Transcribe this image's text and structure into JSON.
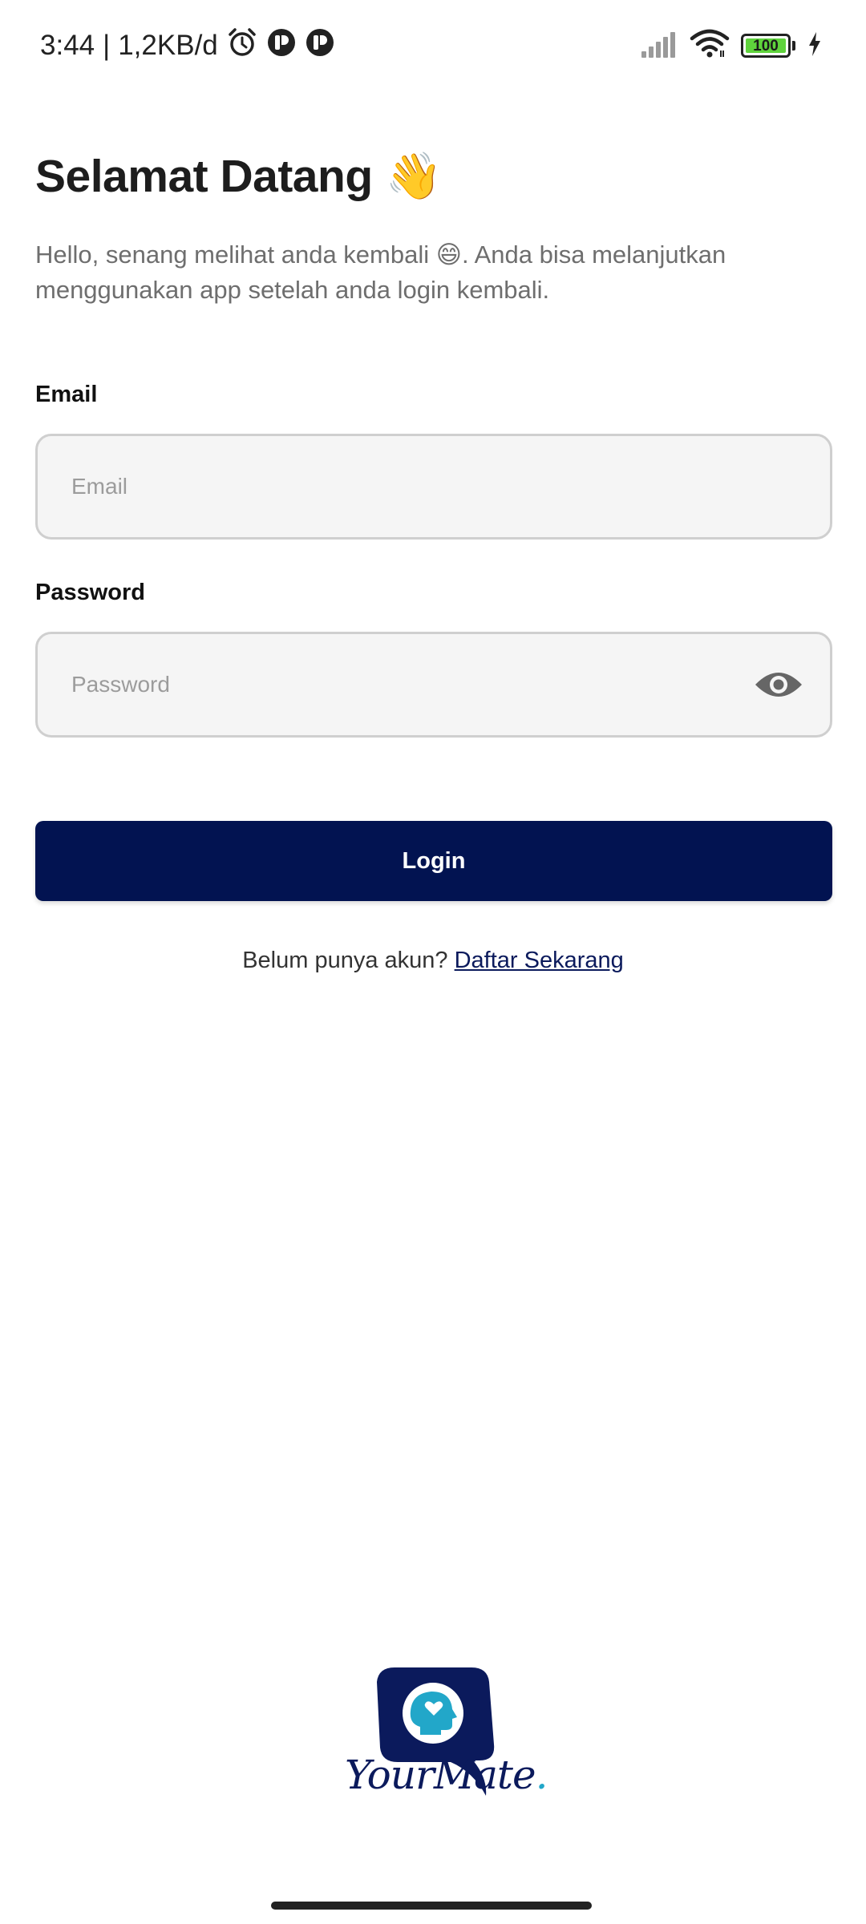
{
  "status_bar": {
    "time": "3:44",
    "separator": "|",
    "network_speed": "1,2KB/d",
    "battery_level": "100",
    "icons": [
      "alarm-icon",
      "app-notification-icon",
      "app-notification-icon",
      "signal-icon",
      "wifi-icon",
      "battery-icon",
      "charging-icon"
    ]
  },
  "welcome": {
    "title": "Selamat Datang",
    "title_emoji": "👋",
    "subtitle": "Hello, senang melihat anda kembali 😄. Anda bisa melanjutkan menggunakan app setelah anda login kembali."
  },
  "form": {
    "email_label": "Email",
    "email_placeholder": "Email",
    "email_value": "",
    "password_label": "Password",
    "password_placeholder": "Password",
    "password_value": "",
    "password_toggle_icon": "eye-icon",
    "login_label": "Login"
  },
  "signup": {
    "prompt": "Belum punya akun?",
    "link_label": "Daftar Sekarang"
  },
  "brand": {
    "logo_icon": "yourmate-logo-icon",
    "wordmark": "YourMate",
    "wordmark_dot": "."
  },
  "colors": {
    "primary": "#021351",
    "accent": "#22a7c9",
    "input_bg": "#f5f5f5",
    "input_border": "#cfcfcf",
    "subtitle_text": "#6e6e6e"
  }
}
